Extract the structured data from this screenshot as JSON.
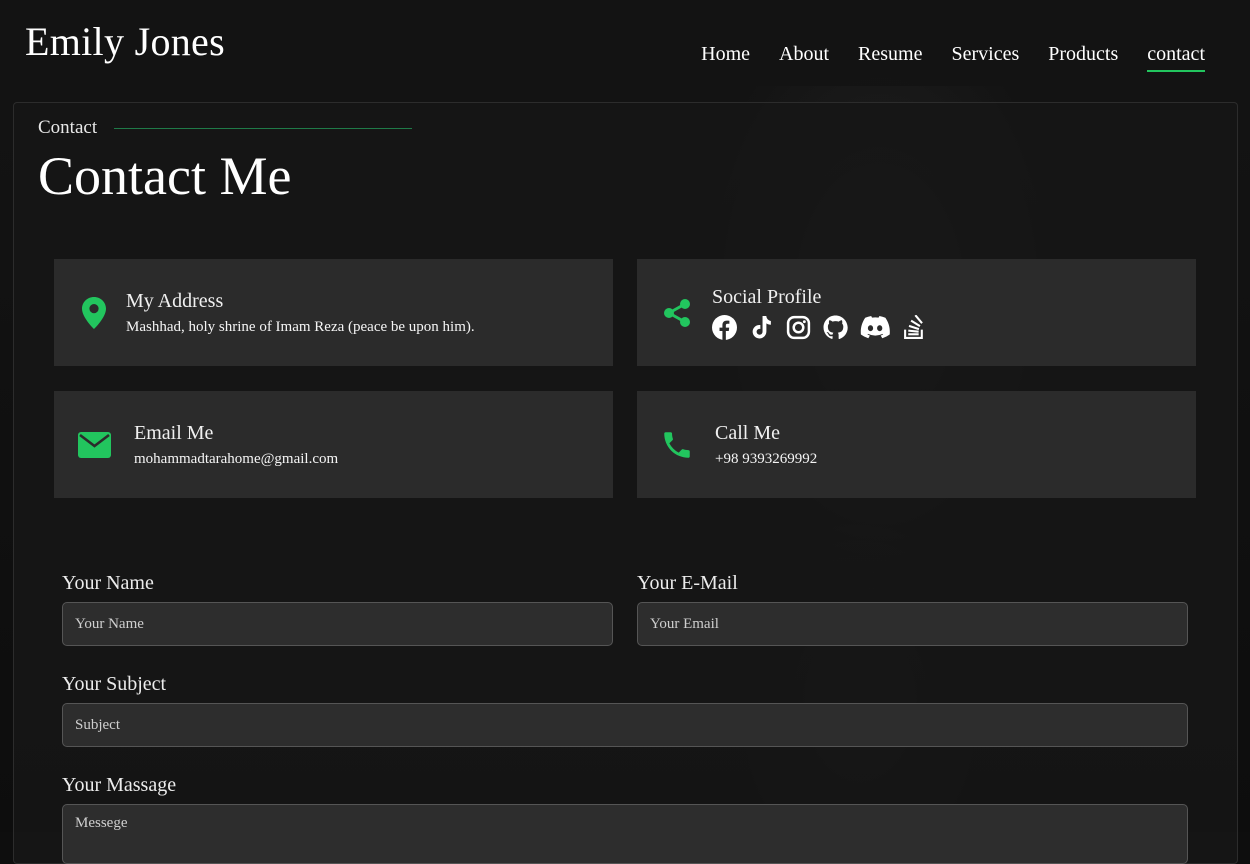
{
  "header": {
    "brand": "Emily Jones",
    "nav": [
      {
        "label": "Home"
      },
      {
        "label": "About"
      },
      {
        "label": "Resume"
      },
      {
        "label": "Services"
      },
      {
        "label": "Products"
      },
      {
        "label": "contact",
        "active": true
      }
    ]
  },
  "section": {
    "eyebrow": "Contact",
    "title": "Contact Me"
  },
  "cards": {
    "address": {
      "title": "My Address",
      "text": "Mashhad, holy shrine of Imam Reza (peace be upon him).",
      "icon": "map-pin-icon"
    },
    "social": {
      "title": "Social Profile",
      "icon": "share-icon",
      "links": [
        "facebook-icon",
        "tiktok-icon",
        "instagram-icon",
        "github-icon",
        "discord-icon",
        "stack-overflow-icon"
      ]
    },
    "email": {
      "title": "Email Me",
      "text": "mohammadtarahome@gmail.com",
      "icon": "envelope-icon"
    },
    "phone": {
      "title": "Call Me",
      "text": "+98 9393269992",
      "icon": "phone-icon"
    }
  },
  "form": {
    "name_label": "Your Name",
    "name_placeholder": "Your Name",
    "email_label": "Your E-Mail",
    "email_placeholder": "Your Email",
    "subject_label": "Your Subject",
    "subject_placeholder": "Subject",
    "message_label": "Your Massage",
    "message_placeholder": "Messege"
  },
  "colors": {
    "accent": "#22c55e",
    "card_bg": "#2b2b2b",
    "page_bg": "#0e0e0e"
  }
}
